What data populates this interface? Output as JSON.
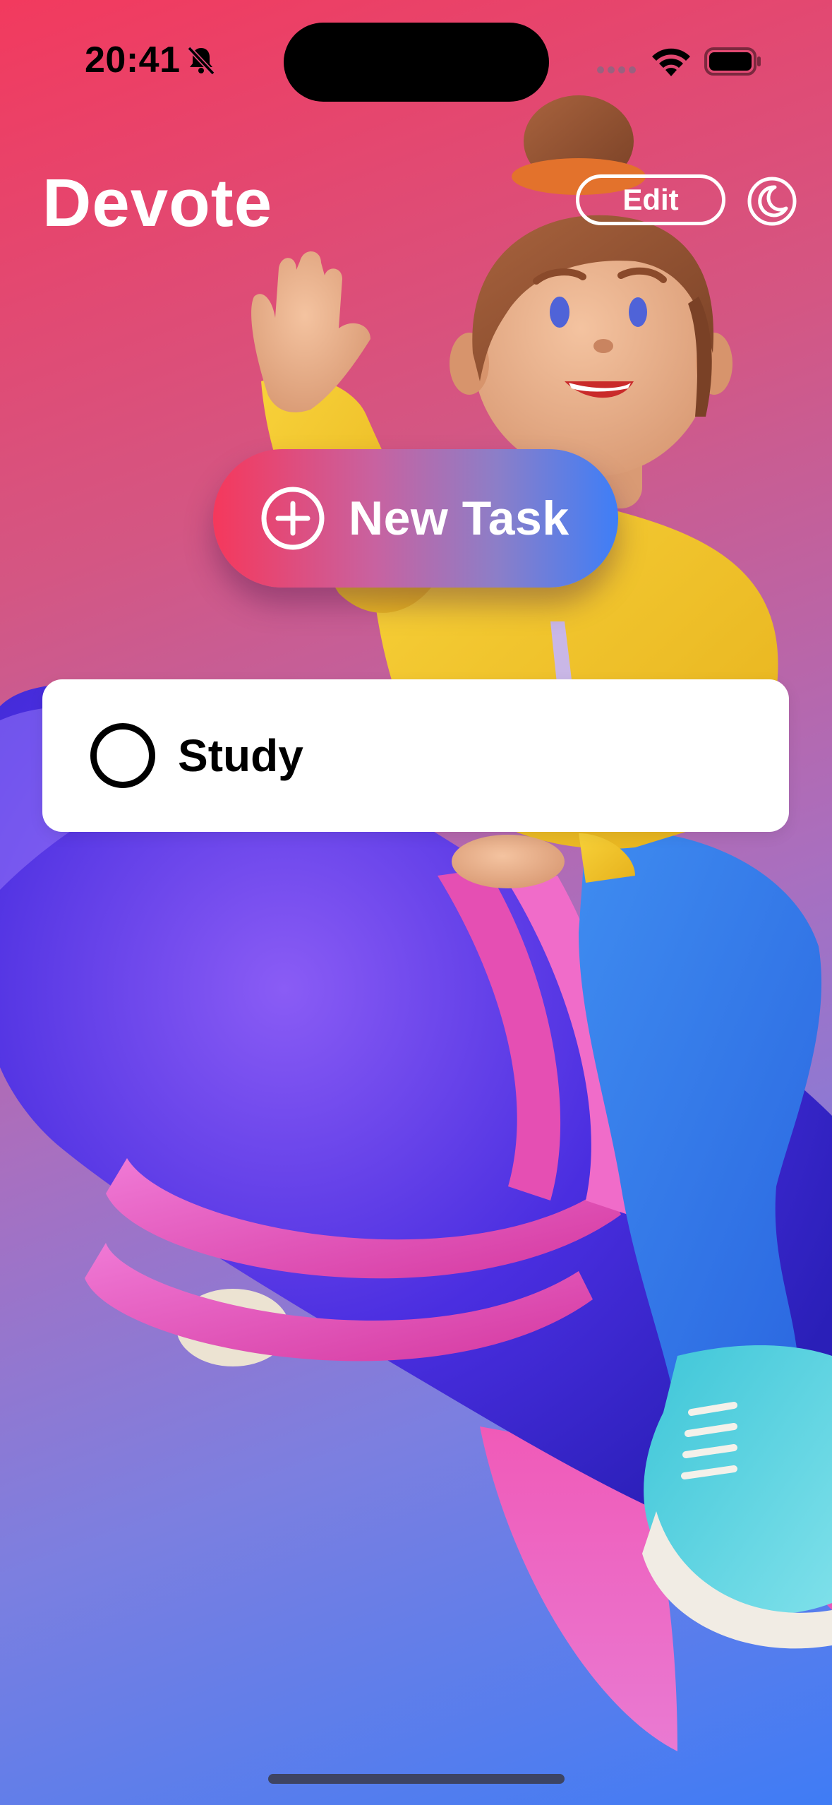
{
  "status_bar": {
    "time": "20:41",
    "silent_icon": "bell-slash-icon",
    "signal_icon": "cellular-signal-icon",
    "wifi_icon": "wifi-icon",
    "battery_icon": "battery-icon"
  },
  "header": {
    "title": "Devote",
    "edit_label": "Edit",
    "theme_icon": "moon-icon"
  },
  "new_task": {
    "label": "New Task",
    "icon": "plus-circle-icon"
  },
  "tasks": [
    {
      "title": "Study",
      "completed": false
    }
  ],
  "illustration": "girl-riding-rocket-illustration",
  "colors": {
    "background_top": "#f23a5e",
    "background_bottom": "#3f7cf5",
    "button_gradient_start": "#f5385c",
    "button_gradient_end": "#3e7ef7",
    "card_background": "#ffffff",
    "text_light": "#ffffff",
    "text_dark": "#000000"
  }
}
